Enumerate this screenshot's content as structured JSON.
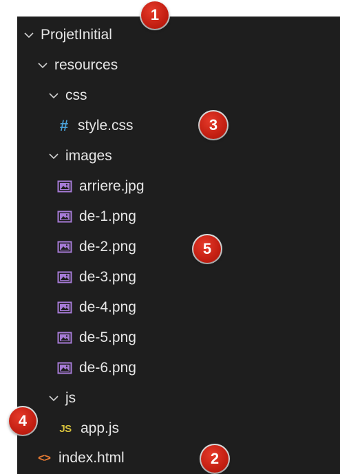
{
  "explorer": {
    "root": {
      "label": "ProjetInitial"
    },
    "resources": {
      "label": "resources"
    },
    "css": {
      "label": "css"
    },
    "style_css": {
      "label": "style.css",
      "icon": "#"
    },
    "images": {
      "label": "images"
    },
    "image_files": [
      {
        "label": "arriere.jpg"
      },
      {
        "label": "de-1.png"
      },
      {
        "label": "de-2.png"
      },
      {
        "label": "de-3.png"
      },
      {
        "label": "de-4.png"
      },
      {
        "label": "de-5.png"
      },
      {
        "label": "de-6.png"
      }
    ],
    "js": {
      "label": "js"
    },
    "app_js": {
      "label": "app.js",
      "icon": "JS"
    },
    "index_html": {
      "label": "index.html",
      "icon": "<>"
    }
  },
  "badges": [
    {
      "number": "1"
    },
    {
      "number": "2"
    },
    {
      "number": "3"
    },
    {
      "number": "4"
    },
    {
      "number": "5"
    }
  ],
  "colors": {
    "background": "#1e1e1e",
    "text": "#e6e6e6",
    "css_icon": "#4aa1d8",
    "image_icon": "#a67bd6",
    "js_icon": "#d7c23c",
    "html_icon": "#e37933",
    "badge": "#c31f12"
  }
}
